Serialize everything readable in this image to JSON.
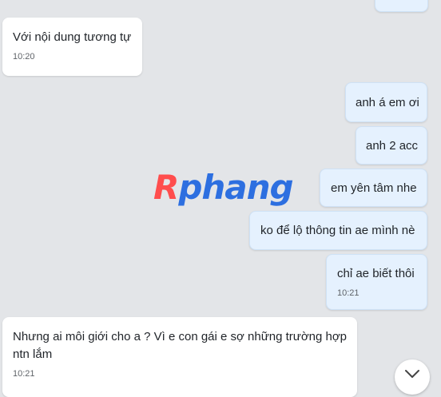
{
  "messages": [
    {
      "id": "m0",
      "side": "out",
      "text": "",
      "time": ""
    },
    {
      "id": "m1",
      "side": "in",
      "text": "Với nội dung tương tự",
      "time": "10:20"
    },
    {
      "id": "m2",
      "side": "out",
      "text": "anh á em ơi",
      "time": ""
    },
    {
      "id": "m3",
      "side": "out",
      "text": "anh 2 acc",
      "time": ""
    },
    {
      "id": "m4",
      "side": "out",
      "text": "em yên tâm nhe",
      "time": ""
    },
    {
      "id": "m5",
      "side": "out",
      "text": "ko để lộ thông tin ae mình nè",
      "time": ""
    },
    {
      "id": "m6",
      "side": "out",
      "text": "chỉ ae biết thôi",
      "time": "10:21"
    },
    {
      "id": "m7",
      "side": "in",
      "text": "Nhưng ai môi giới cho a ? Vì e con gái e sợ những trường hợp ntn lắm",
      "time": "10:21"
    }
  ],
  "watermark": {
    "part1": "R",
    "part2": "phang"
  },
  "scroll_button": {
    "icon": "chevron-down-icon"
  },
  "colors": {
    "background": "#e3e5e8",
    "incoming": "#ffffff",
    "outgoing": "#e5f1fe"
  }
}
